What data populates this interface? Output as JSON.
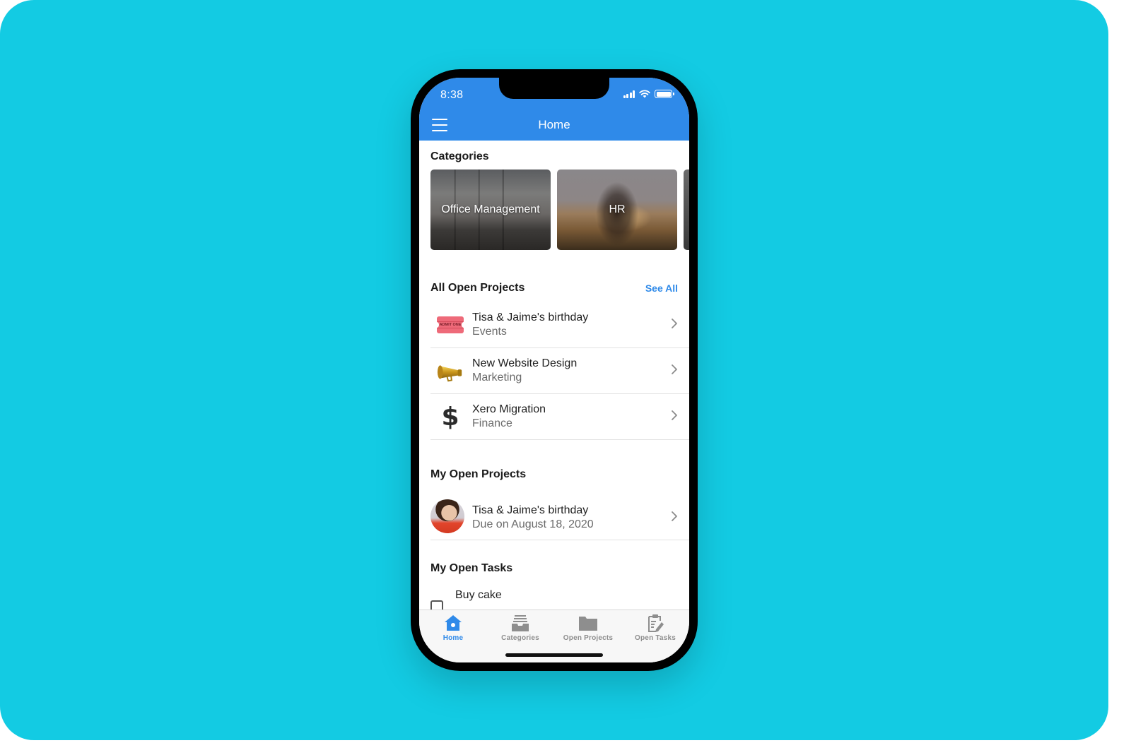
{
  "status_bar": {
    "time": "8:38",
    "signal_icon": "cellular-signal-icon",
    "wifi_icon": "wifi-icon",
    "battery_icon": "battery-icon"
  },
  "nav": {
    "title": "Home",
    "menu_icon": "hamburger-menu-icon"
  },
  "colors": {
    "accent": "#2f8ae9",
    "background": "#13cbe3"
  },
  "categories": {
    "title": "Categories",
    "items": [
      {
        "label": "Office Management"
      },
      {
        "label": "HR"
      }
    ]
  },
  "all_open_projects": {
    "title": "All Open Projects",
    "see_all": "See All",
    "items": [
      {
        "title": "Tisa & Jaime's birthday",
        "subtitle": "Events",
        "icon": "ticket-icon",
        "icon_text": "ADMIT ONE"
      },
      {
        "title": "New Website Design",
        "subtitle": "Marketing",
        "icon": "megaphone-icon"
      },
      {
        "title": "Xero Migration",
        "subtitle": "Finance",
        "icon": "dollar-icon",
        "icon_text": "$"
      }
    ]
  },
  "my_open_projects": {
    "title": "My Open Projects",
    "items": [
      {
        "title": "Tisa & Jaime's birthday",
        "subtitle": "Due on August 18, 2020",
        "icon": "avatar"
      }
    ]
  },
  "my_open_tasks": {
    "title": "My Open Tasks",
    "items": [
      {
        "title": "Buy cake",
        "checked": false
      }
    ]
  },
  "tabbar": {
    "items": [
      {
        "label": "Home",
        "icon": "home-icon",
        "active": true
      },
      {
        "label": "Categories",
        "icon": "inbox-tray-icon",
        "active": false
      },
      {
        "label": "Open Projects",
        "icon": "folder-icon",
        "active": false
      },
      {
        "label": "Open Tasks",
        "icon": "clipboard-edit-icon",
        "active": false
      }
    ]
  }
}
